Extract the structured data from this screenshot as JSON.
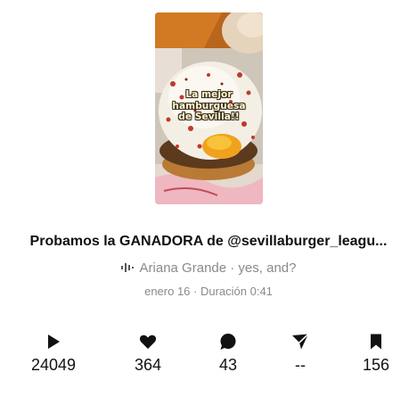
{
  "thumbnail": {
    "overlay_text": "La mejor hamburguesa de Sevilla!!"
  },
  "post": {
    "title": "Probamos la GANADORA de @sevillaburger_leagu...",
    "music": "Ariana Grande · yes, and?",
    "date_duration": "enero 16 · Duración 0:41"
  },
  "stats": [
    {
      "icon": "play-icon",
      "value": "24049"
    },
    {
      "icon": "heart-icon",
      "value": "364"
    },
    {
      "icon": "comment-icon",
      "value": "43"
    },
    {
      "icon": "share-icon",
      "value": "--"
    },
    {
      "icon": "bookmark-icon",
      "value": "156"
    }
  ]
}
